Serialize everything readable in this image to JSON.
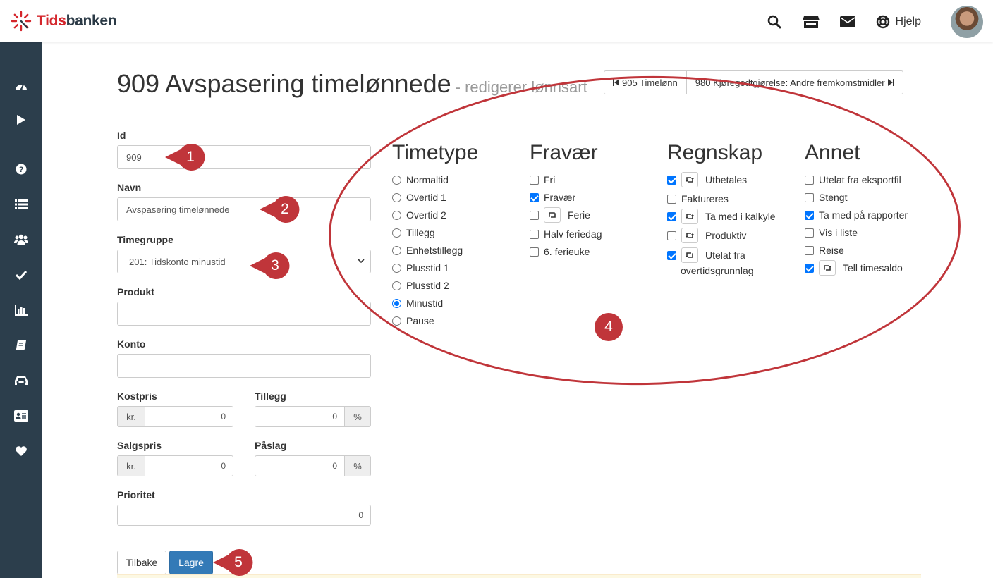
{
  "app": {
    "logo_part1": "Tids",
    "logo_part2": "banken",
    "help_label": "Hjelp",
    "brand_color": "#d4252b"
  },
  "sidebar": {
    "icons": [
      "dashboard-icon",
      "play-icon",
      "question-icon",
      "list-icon",
      "users-icon",
      "check-icon",
      "bar-chart-icon",
      "book-icon",
      "car-icon",
      "id-card-icon",
      "heart-icon"
    ]
  },
  "header": {
    "title": "909 Avspasering timelønnede",
    "subtitle": "- redigerer lønnsart",
    "prev_label": "905 Timelønn",
    "next_label": "980 Kjøregodtgjørelse: Andre fremkomstmidler"
  },
  "form": {
    "id_label": "Id",
    "id_value": "909",
    "navn_label": "Navn",
    "navn_value": "Avspasering timelønnede",
    "timegruppe_label": "Timegruppe",
    "timegruppe_value": "201: Tidskonto minustid",
    "produkt_label": "Produkt",
    "produkt_value": "",
    "konto_label": "Konto",
    "konto_value": "",
    "kostpris_label": "Kostpris",
    "kostpris_prefix": "kr.",
    "kostpris_value": "0",
    "tillegg_label": "Tillegg",
    "tillegg_value": "0",
    "tillegg_suffix": "%",
    "salgspris_label": "Salgspris",
    "salgspris_prefix": "kr.",
    "salgspris_value": "0",
    "paslag_label": "Påslag",
    "paslag_value": "0",
    "paslag_suffix": "%",
    "prioritet_label": "Prioritet",
    "prioritet_value": "0",
    "back_label": "Tilbake",
    "save_label": "Lagre"
  },
  "timetype": {
    "heading": "Timetype",
    "options": [
      "Normaltid",
      "Overtid 1",
      "Overtid 2",
      "Tillegg",
      "Enhetstillegg",
      "Plusstid 1",
      "Plusstid 2",
      "Minustid",
      "Pause"
    ],
    "selected": "Minustid"
  },
  "fravaer": {
    "heading": "Fravær",
    "items": [
      {
        "label": "Fri",
        "checked": false
      },
      {
        "label": "Fravær",
        "checked": true
      },
      {
        "label": "Ferie",
        "checked": false
      },
      {
        "label": "Halv feriedag",
        "checked": false
      },
      {
        "label": "6. ferieuke",
        "checked": false
      }
    ]
  },
  "regnskap": {
    "heading": "Regnskap",
    "items": [
      {
        "label": "Utbetales",
        "checked": true
      },
      {
        "label": "Faktureres",
        "checked": false
      },
      {
        "label": "Ta med i kalkyle",
        "checked": true
      },
      {
        "label": "Produktiv",
        "checked": false
      },
      {
        "label": "Utelat fra",
        "label_line2": "overtidsgrunnlag",
        "checked": true
      }
    ]
  },
  "annet": {
    "heading": "Annet",
    "items": [
      {
        "label": "Utelat fra eksportfil",
        "checked": false
      },
      {
        "label": "Stengt",
        "checked": false
      },
      {
        "label": "Ta med på rapporter",
        "checked": true
      },
      {
        "label": "Vis i liste",
        "checked": false
      },
      {
        "label": "Reise",
        "checked": false
      },
      {
        "label": "Tell timesaldo",
        "checked": true
      }
    ]
  },
  "annotations": {
    "markers": [
      "1",
      "2",
      "3",
      "4",
      "5"
    ],
    "color": "#c0353a"
  }
}
